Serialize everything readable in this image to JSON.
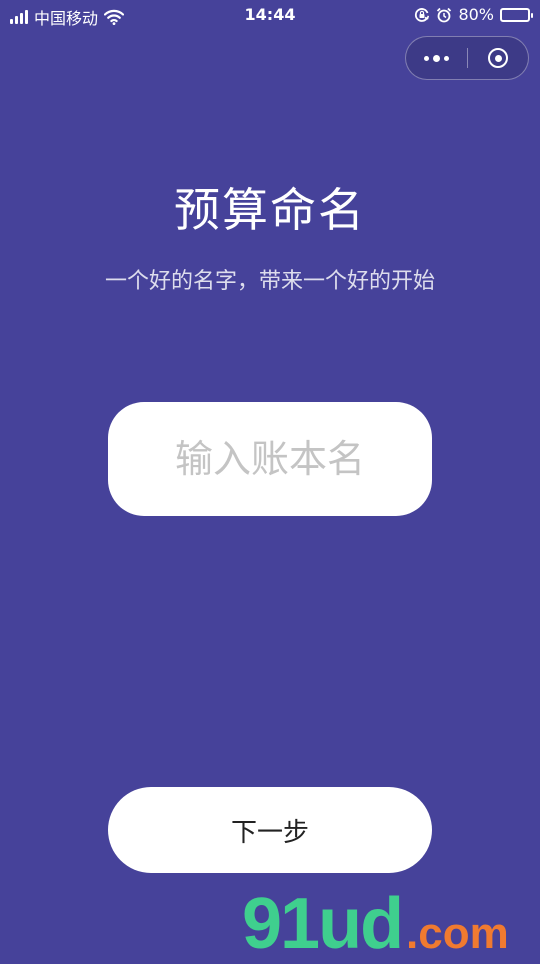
{
  "status_bar": {
    "carrier": "中国移动",
    "time": "14:44",
    "battery_percent": "80%",
    "battery_level": 0.8,
    "icons": [
      "signal-icon",
      "wifi-icon",
      "orientation-lock-icon",
      "alarm-icon",
      "battery-icon"
    ]
  },
  "capsule": {
    "more_icon": "more-dots-icon",
    "close_icon": "target-circle-icon"
  },
  "page": {
    "title": "预算命名",
    "subtitle": "一个好的名字，带来一个好的开始"
  },
  "input": {
    "placeholder": "输入账本名",
    "value": ""
  },
  "next_button": {
    "label": "下一步"
  },
  "watermark": {
    "main": "91ud",
    "tld": ".com"
  },
  "colors": {
    "background": "#46429a",
    "surface": "#ffffff",
    "placeholder": "#c4c4c4",
    "watermark_green": "#3fcf8e",
    "watermark_orange": "#f07a30"
  }
}
